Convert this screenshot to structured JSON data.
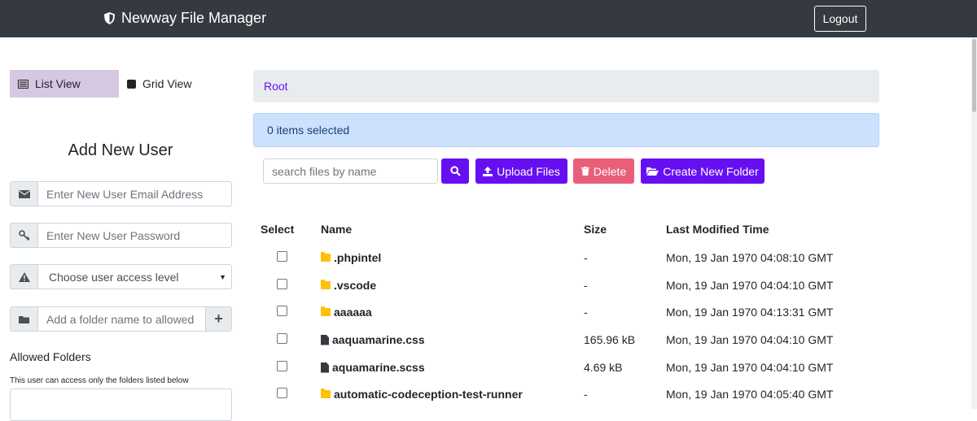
{
  "header": {
    "title": "Newway File Manager",
    "logout_label": "Logout"
  },
  "view_toggle": {
    "list_label": "List View",
    "grid_label": "Grid View"
  },
  "add_user": {
    "title": "Add New User",
    "email_placeholder": "Enter New User Email Address",
    "password_placeholder": "Enter New User Password",
    "access_select_value": "Choose user access level",
    "folder_placeholder": "Add a folder name to allowed",
    "allowed_heading": "Allowed Folders",
    "allowed_note": "This user can access only the folders listed below"
  },
  "breadcrumb": {
    "root": "Root"
  },
  "selection": {
    "status": "0 items selected"
  },
  "toolbar": {
    "search_placeholder": "search files by name",
    "upload_label": "Upload Files",
    "delete_label": "Delete",
    "new_folder_label": "Create New Folder"
  },
  "table": {
    "columns": [
      "Select",
      "Name",
      "Size",
      "Last Modified Time"
    ],
    "rows": [
      {
        "type": "folder",
        "name": ".phpintel",
        "size": "-",
        "modified": "Mon, 19 Jan 1970 04:08:10 GMT"
      },
      {
        "type": "folder",
        "name": ".vscode",
        "size": "-",
        "modified": "Mon, 19 Jan 1970 04:04:10 GMT"
      },
      {
        "type": "folder",
        "name": "aaaaaa",
        "size": "-",
        "modified": "Mon, 19 Jan 1970 04:13:31 GMT"
      },
      {
        "type": "file",
        "name": "aaquamarine.css",
        "size": "165.96 kB",
        "modified": "Mon, 19 Jan 1970 04:04:10 GMT"
      },
      {
        "type": "file",
        "name": "aquamarine.scss",
        "size": "4.69 kB",
        "modified": "Mon, 19 Jan 1970 04:04:10 GMT"
      },
      {
        "type": "folder",
        "name": "automatic-codeception-test-runner",
        "size": "-",
        "modified": "Mon, 19 Jan 1970 04:05:40 GMT"
      }
    ]
  },
  "colors": {
    "navbar": "#343a40",
    "accent": "#6610f2",
    "danger": "#e95f7a",
    "list_view_active": "#d6c8e3",
    "alert_bg": "#cce1fd",
    "folder": "#ffc107"
  }
}
